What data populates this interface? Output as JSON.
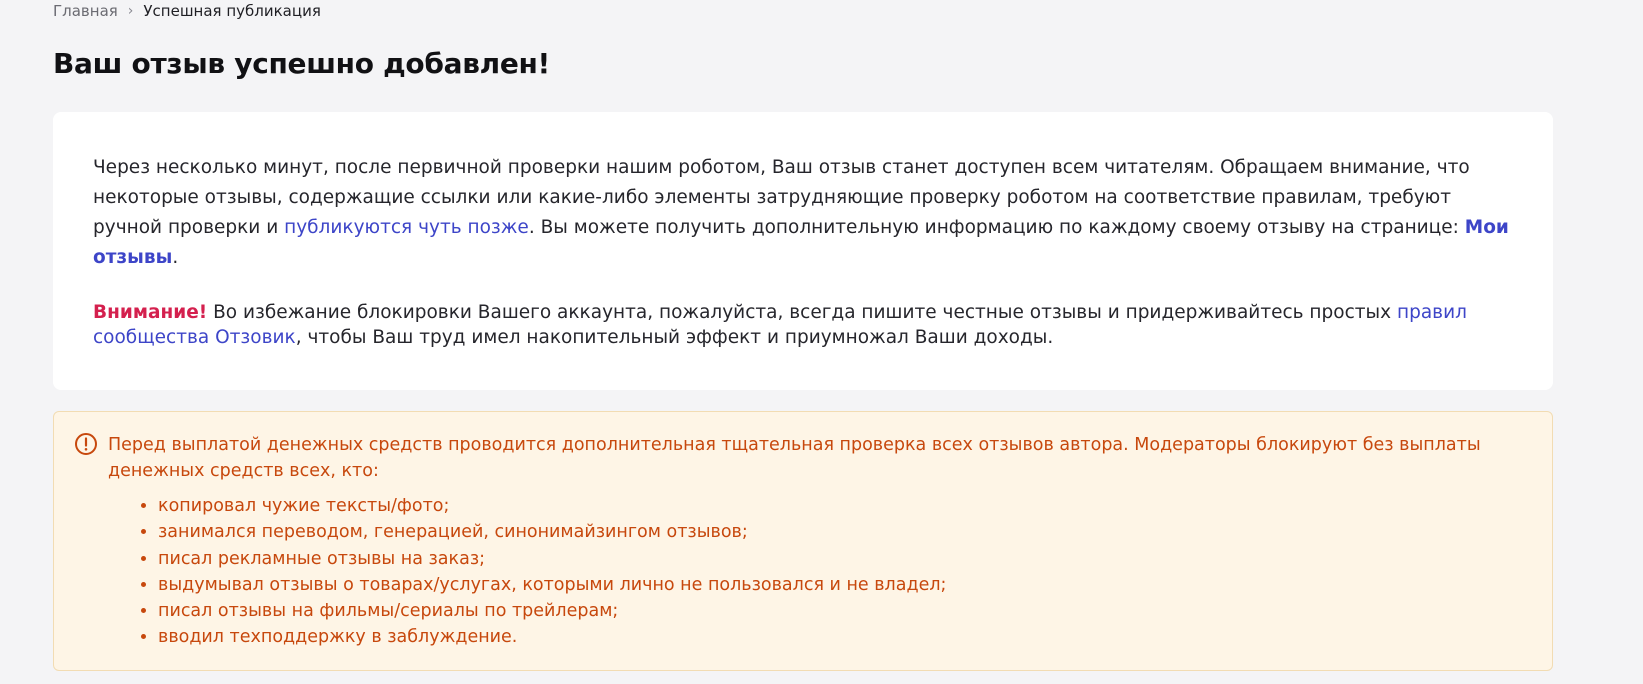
{
  "breadcrumb": {
    "home": "Главная",
    "separator": "›",
    "current": "Успешная публикация"
  },
  "page": {
    "title": "Ваш отзыв успешно добавлен!"
  },
  "info_card": {
    "paragraph1_part1": "Через несколько минут, после первичной проверки нашим роботом, Ваш отзыв станет доступен всем читателям. Обращаем внимание, что некоторые отзывы, содержащие ссылки или какие-либо элементы затрудняющие проверку роботом на соответствие правилам, требуют ручной проверки и ",
    "paragraph1_link1": "публикуются чуть позже",
    "paragraph1_part2": ". Вы можете получить дополнительную информацию по каждому своему отзыву на странице: ",
    "paragraph1_link2": "Мои отзывы",
    "paragraph1_end": ".",
    "warning_label": "Внимание!",
    "warning_part1": " Во избежание блокировки Вашего аккаунта, пожалуйста, всегда пишите честные отзывы и придерживайтесь простых ",
    "warning_link": "правил сообщества Отзовик",
    "warning_part2": ", чтобы Ваш труд имел накопительный эффект и приумножал Ваши доходы."
  },
  "alert": {
    "icon": "exclamation-circle-icon",
    "text": "Перед выплатой денежных средств проводится дополнительная тщательная проверка всех отзывов автора. Модераторы блокируют без выплаты денежных средств всех, кто:",
    "items": [
      "копировал чужие тексты/фото;",
      "занимался переводом, генерацией, синонимайзингом отзывов;",
      "писал рекламные отзывы на заказ;",
      "выдумывал отзывы о товарах/услугах, которыми лично не пользовался и не владел;",
      "писал отзывы на фильмы/сериалы по трейлерам;",
      "вводил техподдержку в заблуждение."
    ]
  },
  "colors": {
    "page_bg": "#f4f4f6",
    "card_bg": "#ffffff",
    "link": "#3d45c8",
    "attention": "#d4204e",
    "alert_bg": "#fef5e6",
    "alert_border": "#f2dcb3",
    "alert_text": "#c7480d"
  }
}
